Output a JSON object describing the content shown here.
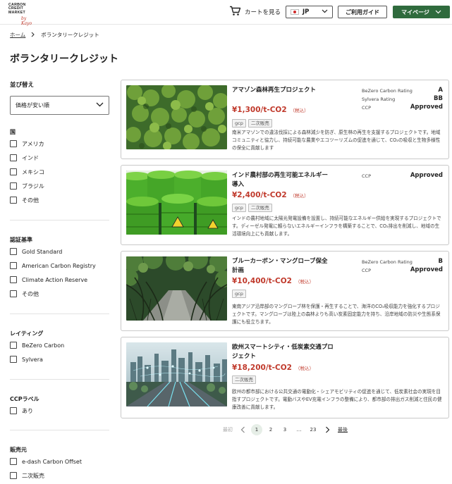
{
  "header": {
    "logo_lines": [
      "CARBON",
      "CREDIT",
      "MARKET"
    ],
    "logo_sign": "by Kayo",
    "cart_label": "カートを見る",
    "lang_label": "JP",
    "guide_label": "ご利用ガイド",
    "mypage_label": "マイページ"
  },
  "breadcrumb": {
    "home": "ホーム",
    "current": "ボランタリークレジット"
  },
  "page_title": "ボランタリークレジット",
  "sort": {
    "label": "並び替え",
    "selected": "価格が安い順"
  },
  "filters": {
    "country": {
      "title": "国",
      "items": [
        "アメリカ",
        "インド",
        "メキシコ",
        "ブラジル",
        "その他"
      ]
    },
    "cert": {
      "title": "認証基準",
      "items": [
        "Gold Standard",
        "American Carbon Registry",
        "Climate Action Reserve",
        "その他"
      ]
    },
    "rating": {
      "title": "レイティング",
      "items": [
        "BeZero Carbon",
        "Sylvera"
      ]
    },
    "ccp": {
      "title": "CCPラベル",
      "items": [
        "あり"
      ]
    },
    "seller": {
      "title": "販売元",
      "items": [
        "e-dash Carbon Offset",
        "二次販売"
      ]
    }
  },
  "products": [
    {
      "title": "アマゾン森林再生プロジェクト",
      "price": "¥1,300/t-CO2",
      "tax": "（税込）",
      "tags": [
        "gcp",
        "二次販売"
      ],
      "description": "南米アマゾンでの違法伐採による森林減少を防ぎ、原生林の再生を支援するプロジェクトです。地域コミュニティと協力し、持続可能な農業やエコツーリズムの促進を通じて、CO₂の吸収と生物多様性の保全に貢献します",
      "ratings": [
        {
          "name": "BeZero Carbon Rating",
          "value": "A"
        },
        {
          "name": "Sylvera Rating",
          "value": "BB"
        },
        {
          "name": "CCP",
          "value": "Approved"
        }
      ]
    },
    {
      "title": "インド農村部の再生可能エネルギー導入",
      "price": "¥2,400/t-CO2",
      "tax": "（税込）",
      "tags": [
        "gcp",
        "二次販売"
      ],
      "description": "インドの農村地域に太陽光発電設備を設置し、持続可能なエネルギー供給を実現するプロジェクトです。ディーゼル発電に頼らないエネルギーインフラを構築することで、CO₂排出を削減し、地域の生活環境向上にも貢献します。",
      "ratings": [
        {
          "name": "CCP",
          "value": "Approved"
        }
      ]
    },
    {
      "title": "ブルーカーボン・マングローブ保全計画",
      "price": "¥10,400/t-CO2",
      "tax": "（税込）",
      "tags": [
        "gcp"
      ],
      "description": "東南アジア沿岸部のマングローブ林を保護・再生することで、海洋のCO₂吸収能力を強化するプロジェクトです。マングローブは陸上の森林よりも高い炭素固定能力を持ち、沿岸地域の防災や生態系保護にも役立ちます。",
      "ratings": [
        {
          "name": "BeZero Carbon Rating",
          "value": "B"
        },
        {
          "name": "CCP",
          "value": "Approved"
        }
      ]
    },
    {
      "title": "欧州スマートシティ・低炭素交通プロジェクト",
      "price": "¥18,200/t-CO2",
      "tax": "（税込）",
      "tags": [
        "二次販売"
      ],
      "description": "欧州の都市部における公共交通の電動化・シェアモビリティの促進を通じて、低炭素社会の実現を目指すプロジェクトです。電動バスやEV充電インフラの整備により、都市部の排出ガス削減と住民の健康改善に貢献します。",
      "ratings": []
    }
  ],
  "pagination": {
    "first": "最初",
    "pages": [
      "1",
      "2",
      "3",
      "…",
      "23"
    ],
    "last": "最後",
    "current": "1"
  },
  "colors": {
    "brand_green": "#2f6b3d",
    "price_red": "#c0392b"
  }
}
